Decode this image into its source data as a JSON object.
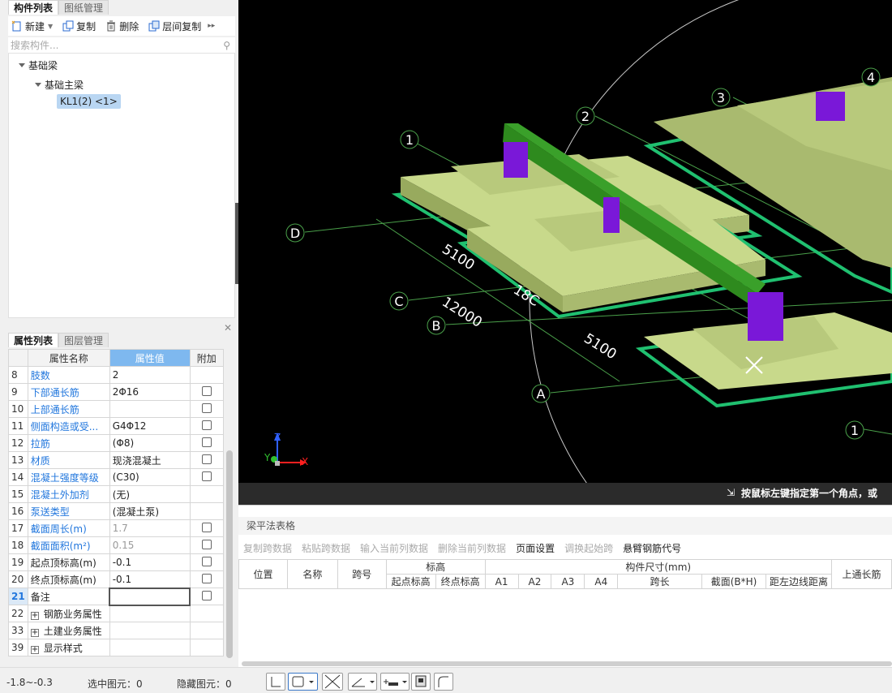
{
  "left_tabs": [
    "构件列表",
    "图纸管理"
  ],
  "toolbar": {
    "new": "新建",
    "copy": "复制",
    "delete": "删除",
    "floor_copy": "层间复制"
  },
  "search_placeholder": "搜索构件...",
  "tree": {
    "root": "基础梁",
    "child": "基础主梁",
    "leaf": "KL1(2) <1>"
  },
  "prop_tabs": [
    "属性列表",
    "图层管理"
  ],
  "prop_headers": [
    "属性名称",
    "属性值",
    "附加"
  ],
  "props": [
    {
      "n": "8",
      "name": "肢数",
      "val": "2",
      "blue": true,
      "cb": false,
      "gray": false
    },
    {
      "n": "9",
      "name": "下部通长筋",
      "val": "2Φ16",
      "blue": true,
      "cb": true,
      "gray": false
    },
    {
      "n": "10",
      "name": "上部通长筋",
      "val": "",
      "blue": true,
      "cb": true,
      "gray": false
    },
    {
      "n": "11",
      "name": "侧面构造或受...",
      "val": "G4Φ12",
      "blue": true,
      "cb": true,
      "gray": false
    },
    {
      "n": "12",
      "name": "拉筋",
      "val": "(Φ8)",
      "blue": true,
      "cb": true,
      "gray": false
    },
    {
      "n": "13",
      "name": "材质",
      "val": "现浇混凝土",
      "blue": true,
      "cb": true,
      "gray": false
    },
    {
      "n": "14",
      "name": "混凝土强度等级",
      "val": "(C30)",
      "blue": true,
      "cb": true,
      "gray": false
    },
    {
      "n": "15",
      "name": "混凝土外加剂",
      "val": "(无)",
      "blue": true,
      "cb": false,
      "gray": false
    },
    {
      "n": "16",
      "name": "泵送类型",
      "val": "(混凝土泵)",
      "blue": true,
      "cb": false,
      "gray": false
    },
    {
      "n": "17",
      "name": "截面周长(m)",
      "val": "1.7",
      "blue": true,
      "cb": true,
      "gray": true
    },
    {
      "n": "18",
      "name": "截面面积(m²)",
      "val": "0.15",
      "blue": true,
      "cb": true,
      "gray": true
    },
    {
      "n": "19",
      "name": "起点顶标高(m)",
      "val": "-0.1",
      "blue": false,
      "cb": true,
      "gray": false
    },
    {
      "n": "20",
      "name": "终点顶标高(m)",
      "val": "-0.1",
      "blue": false,
      "cb": true,
      "gray": false
    },
    {
      "n": "21",
      "name": "备注",
      "val": "",
      "blue": false,
      "cb": true,
      "gray": false
    }
  ],
  "groups": [
    {
      "n": "22",
      "name": "钢筋业务属性"
    },
    {
      "n": "33",
      "name": "土建业务属性"
    },
    {
      "n": "39",
      "name": "显示样式"
    }
  ],
  "axes": {
    "n1": "1",
    "n2": "2",
    "n3": "3",
    "n4": "4",
    "nB": "1",
    "D": "D",
    "C": "C",
    "B": "B",
    "A": "A"
  },
  "dims": {
    "d1": "5100",
    "d2": "12000",
    "d3": "18C",
    "d4": "5100"
  },
  "hint": "按鼠标左键指定第一个角点，或",
  "grid_title": "梁平法表格",
  "grid_tools": [
    {
      "t": "复制跨数据",
      "en": false
    },
    {
      "t": "粘贴跨数据",
      "en": false
    },
    {
      "t": "输入当前列数据",
      "en": false
    },
    {
      "t": "删除当前列数据",
      "en": false
    },
    {
      "t": "页面设置",
      "en": true
    },
    {
      "t": "调换起始跨",
      "en": false
    },
    {
      "t": "悬臂钢筋代号",
      "en": true
    }
  ],
  "grid_head": {
    "pos": "位置",
    "name": "名称",
    "span": "跨号",
    "elev": "标高",
    "start": "起点标高",
    "end": "终点标高",
    "size": "构件尺寸(mm)",
    "a1": "A1",
    "a2": "A2",
    "a3": "A3",
    "a4": "A4",
    "len": "跨长",
    "sect": "截面(B*H)",
    "dist": "距左边线距离",
    "top": "上通长筋"
  },
  "status": {
    "range": "-1.8~-0.3",
    "selected": "选中图元：0",
    "hidden": "隐藏图元：0"
  },
  "colors": {
    "slab": "#a9ba6f",
    "slab_top": "#c8d98b",
    "beam": "#2e8a1e",
    "column": "#7a18d8",
    "edge": "#20c070"
  }
}
